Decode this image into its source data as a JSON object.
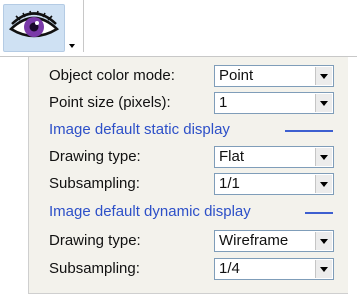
{
  "toolbar": {
    "display_button_icon": "eye-icon",
    "dropdown_icon": "chevron-down-icon"
  },
  "panel": {
    "object_color_mode": {
      "label": "Object color mode:",
      "value": "Point"
    },
    "point_size": {
      "label": "Point size (pixels):",
      "value": "1"
    },
    "static_section": {
      "title": "Image default static display",
      "drawing_type": {
        "label": "Drawing type:",
        "value": "Flat"
      },
      "subsampling": {
        "label": "Subsampling:",
        "value": "1/1"
      }
    },
    "dynamic_section": {
      "title": "Image default dynamic display",
      "drawing_type": {
        "label": "Drawing type:",
        "value": "Wireframe"
      },
      "subsampling": {
        "label": "Subsampling:",
        "value": "1/4"
      }
    }
  },
  "colors": {
    "section_header": "#2d50c8",
    "button_highlight": "#cfe1f3",
    "panel_background": "#f3f2ec"
  }
}
